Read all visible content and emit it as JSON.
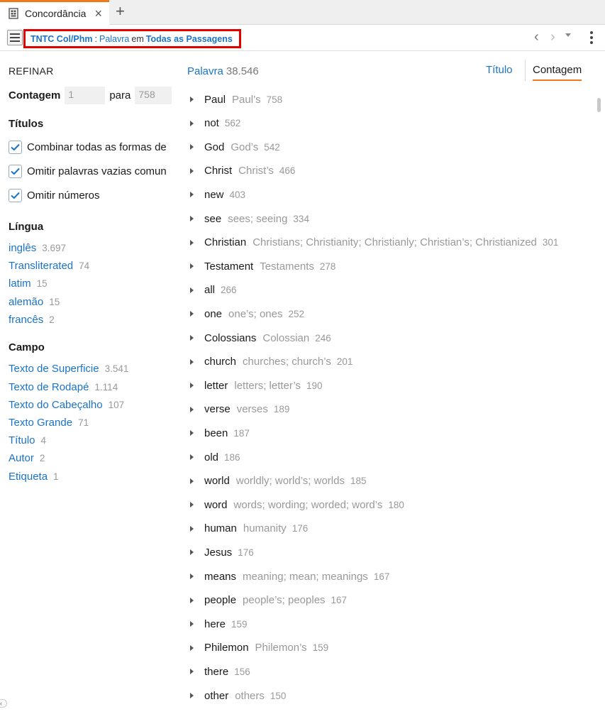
{
  "tab": {
    "title": "Concordância",
    "icon": "book-grid-icon"
  },
  "breadcrumb": {
    "resource": "TNTC Col/Phm",
    "separator": ":",
    "type": "Palavra",
    "conj": "em",
    "scope": "Todas as Passagens"
  },
  "refine": {
    "heading": "REFINAR",
    "count_label": "Contagem",
    "count_from": "1",
    "count_to_label": "para",
    "count_to": "758"
  },
  "titles": {
    "heading": "Títulos",
    "options": [
      {
        "label": "Combinar todas as formas de",
        "checked": true
      },
      {
        "label": "Omitir palavras vazias comun",
        "checked": true
      },
      {
        "label": "Omitir números",
        "checked": true
      }
    ]
  },
  "language": {
    "heading": "Língua",
    "items": [
      {
        "label": "inglês",
        "count": "3.697"
      },
      {
        "label": "Transliterated",
        "count": "74"
      },
      {
        "label": "latim",
        "count": "15"
      },
      {
        "label": "alemão",
        "count": "15"
      },
      {
        "label": "francês",
        "count": "2"
      }
    ]
  },
  "field": {
    "heading": "Campo",
    "items": [
      {
        "label": "Texto de Superficie",
        "count": "3.541"
      },
      {
        "label": "Texto de Rodapé",
        "count": "1.114"
      },
      {
        "label": "Texto do Cabeçalho",
        "count": "107"
      },
      {
        "label": "Texto Grande",
        "count": "71"
      },
      {
        "label": "Título",
        "count": "4"
      },
      {
        "label": "Autor",
        "count": "2"
      },
      {
        "label": "Etiqueta",
        "count": "1"
      }
    ]
  },
  "results": {
    "label": "Palavra",
    "total": "38.546",
    "sort_title": "Título",
    "sort_count": "Contagem",
    "words": [
      {
        "word": "Paul",
        "forms": "Paul’s",
        "count": "758"
      },
      {
        "word": "not",
        "forms": "",
        "count": "562"
      },
      {
        "word": "God",
        "forms": "God’s",
        "count": "542"
      },
      {
        "word": "Christ",
        "forms": "Christ’s",
        "count": "466"
      },
      {
        "word": "new",
        "forms": "",
        "count": "403"
      },
      {
        "word": "see",
        "forms": "sees; seeing",
        "count": "334"
      },
      {
        "word": "Christian",
        "forms": "Christians; Christianity; Christianly; Christian’s; Christianized",
        "count": "301"
      },
      {
        "word": "Testament",
        "forms": "Testaments",
        "count": "278"
      },
      {
        "word": "all",
        "forms": "",
        "count": "266"
      },
      {
        "word": "one",
        "forms": "one’s; ones",
        "count": "252"
      },
      {
        "word": "Colossians",
        "forms": "Colossian",
        "count": "246"
      },
      {
        "word": "church",
        "forms": "churches; church’s",
        "count": "201"
      },
      {
        "word": "letter",
        "forms": "letters; letter’s",
        "count": "190"
      },
      {
        "word": "verse",
        "forms": "verses",
        "count": "189"
      },
      {
        "word": "been",
        "forms": "",
        "count": "187"
      },
      {
        "word": "old",
        "forms": "",
        "count": "186"
      },
      {
        "word": "world",
        "forms": "worldly; world’s; worlds",
        "count": "185"
      },
      {
        "word": "word",
        "forms": "words; wording; worded; word’s",
        "count": "180"
      },
      {
        "word": "human",
        "forms": "humanity",
        "count": "176"
      },
      {
        "word": "Jesus",
        "forms": "",
        "count": "176"
      },
      {
        "word": "means",
        "forms": "meaning; mean; meanings",
        "count": "167"
      },
      {
        "word": "people",
        "forms": "people’s; peoples",
        "count": "167"
      },
      {
        "word": "here",
        "forms": "",
        "count": "159"
      },
      {
        "word": "Philemon",
        "forms": "Philemon’s",
        "count": "159"
      },
      {
        "word": "there",
        "forms": "",
        "count": "156"
      },
      {
        "word": "other",
        "forms": "others",
        "count": "150"
      }
    ]
  },
  "colors": {
    "accent": "#f07a1b",
    "link": "#1a73c9",
    "highlight_box": "#e00000"
  }
}
